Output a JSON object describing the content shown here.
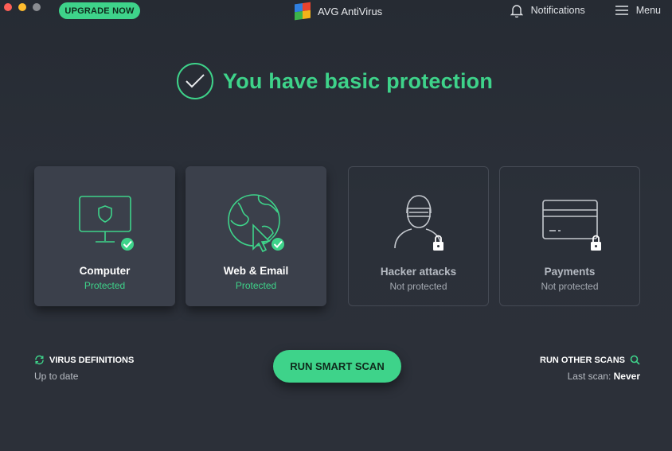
{
  "window": {
    "traffic_lights": [
      "close",
      "minimize",
      "zoom"
    ]
  },
  "header": {
    "upgrade_label": "UPGRADE NOW",
    "app_title": "AVG AntiVirus",
    "notifications_label": "Notifications",
    "menu_label": "Menu"
  },
  "hero": {
    "title": "You have basic protection",
    "icon": "check-circle-icon"
  },
  "cards": [
    {
      "label": "Computer",
      "status": "Protected",
      "icon": "monitor-shield-icon",
      "protected": true
    },
    {
      "label": "Web & Email",
      "status": "Protected",
      "icon": "globe-cursor-icon",
      "protected": true
    },
    {
      "label": "Hacker attacks",
      "status": "Not protected",
      "icon": "hacker-icon",
      "protected": false
    },
    {
      "label": "Payments",
      "status": "Not protected",
      "icon": "credit-card-icon",
      "protected": false
    }
  ],
  "virus_definitions": {
    "title": "VIRUS DEFINITIONS",
    "status": "Up to date"
  },
  "scan": {
    "label": "RUN SMART SCAN"
  },
  "other_scans": {
    "title": "RUN OTHER SCANS",
    "last_scan_label": "Last scan:",
    "last_scan_value": "Never"
  },
  "colors": {
    "accent": "#3ed38a",
    "background": "#2a2f38",
    "card": "#3b404b"
  }
}
